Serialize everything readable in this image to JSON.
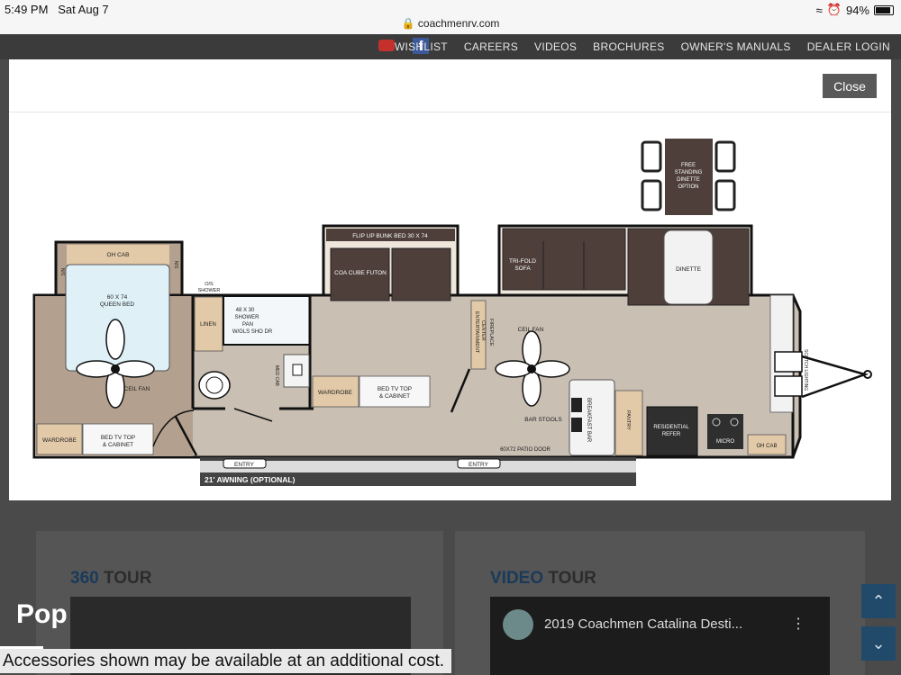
{
  "status": {
    "time": "5:49 PM",
    "date": "Sat Aug 7",
    "url": "coachmenrv.com",
    "battery": "94%"
  },
  "nav": {
    "links": [
      "WISHLIST",
      "CAREERS",
      "VIDEOS",
      "BROCHURES",
      "OWNER'S MANUALS",
      "DEALER LOGIN"
    ]
  },
  "modal": {
    "close_label": "Close"
  },
  "floorplan": {
    "oh_cab_left": "OH CAB",
    "ns_left": "N/S",
    "ns_right": "N/S",
    "queen_bed_1": "60 X 74",
    "queen_bed_2": "QUEEN BED",
    "ceil_fan_left": "CEIL FAN",
    "wardrobe_left": "WARDROBE",
    "bed_tv_left_1": "BED TV TOP",
    "bed_tv_left_2": "& CABINET",
    "os_shower_1": "O/S",
    "os_shower_2": "SHOWER",
    "linen": "LINEN",
    "shower_1": "48 X 30",
    "shower_2": "SHOWER",
    "shower_3": "PAN",
    "shower_4": "W/GLS SHO DR",
    "med_cab": "MED CAB",
    "wardrobe_mid": "WARDROBE",
    "bed_tv_mid_1": "BED TV TOP",
    "bed_tv_mid_2": "& CABINET",
    "bunk_bed": "FLIP UP BUNK BED 30 X 74",
    "futon": "COA CUBE FUTON",
    "ent_center_1": "ENTERTAINMENT",
    "ent_center_2": "CENTER",
    "fireplace": "FIREPLACE",
    "trifold_1": "TRI-FOLD",
    "trifold_2": "SOFA",
    "dinette": "DINETTE",
    "free_dinette_1": "FREE",
    "free_dinette_2": "STANDING",
    "free_dinette_3": "DINETTE",
    "free_dinette_4": "OPTION",
    "ceil_fan_mid": "CEIL FAN",
    "bar_stools": "BAR STOOLS",
    "breakfast_bar": "BREAKFAST BAR",
    "pantry": "PANTRY",
    "refer_1": "RESIDENTIAL",
    "refer_2": "REFER",
    "micro": "MICRO",
    "oh_cab_right": "OH CAB",
    "scotch_lighting": "SCOTCH LIGHTING",
    "patio_door": "60X72 PATIO DOOR",
    "entry_left": "ENTRY",
    "entry_right": "ENTRY",
    "awning": "21' AWNING (OPTIONAL)"
  },
  "tours": {
    "t360_a": "360",
    "t360_b": " TOUR",
    "video_a": "VIDEO",
    "video_b": " TOUR",
    "video_title": "2019 Coachmen Catalina Desti..."
  },
  "overlay": {
    "pop": "Pop",
    "disclaimer": "Accessories shown may be available at an additional cost."
  },
  "colors": {
    "nav_bg": "#3b3b3b",
    "modal_bg": "#ffffff",
    "floor": "#c9bfb3",
    "bedroom_floor": "#b3a08e",
    "dark_furniture": "#4e3f3a",
    "wood": "#e2c9a8",
    "side_button": "#214a6a"
  }
}
